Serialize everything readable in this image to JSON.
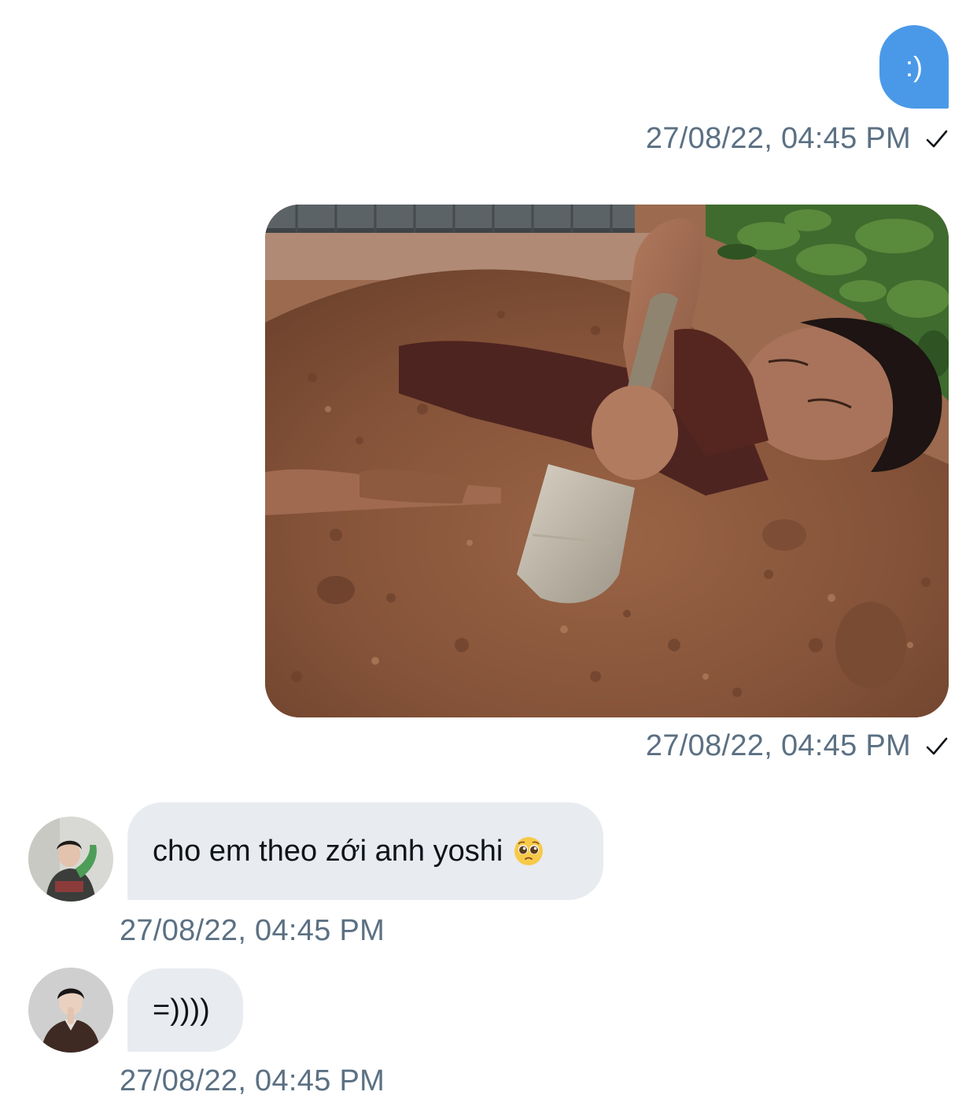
{
  "messages": [
    {
      "direction": "outgoing",
      "text": ":)",
      "timestamp": "27/08/22, 04:45 PM",
      "status_icon": "check-icon"
    },
    {
      "direction": "outgoing",
      "type": "image",
      "timestamp": "27/08/22, 04:45 PM",
      "status_icon": "check-icon"
    },
    {
      "direction": "incoming",
      "text": "cho em theo zới anh yoshi",
      "emoji_icon": "pleading-face-icon",
      "timestamp": "27/08/22, 04:45 PM"
    },
    {
      "direction": "incoming",
      "text": "=))))",
      "timestamp": "27/08/22, 04:45 PM"
    }
  ],
  "colors": {
    "outgoing_bubble": "#4a99e9",
    "incoming_bubble": "#e8ebef",
    "timestamp_text": "#5b7083"
  }
}
